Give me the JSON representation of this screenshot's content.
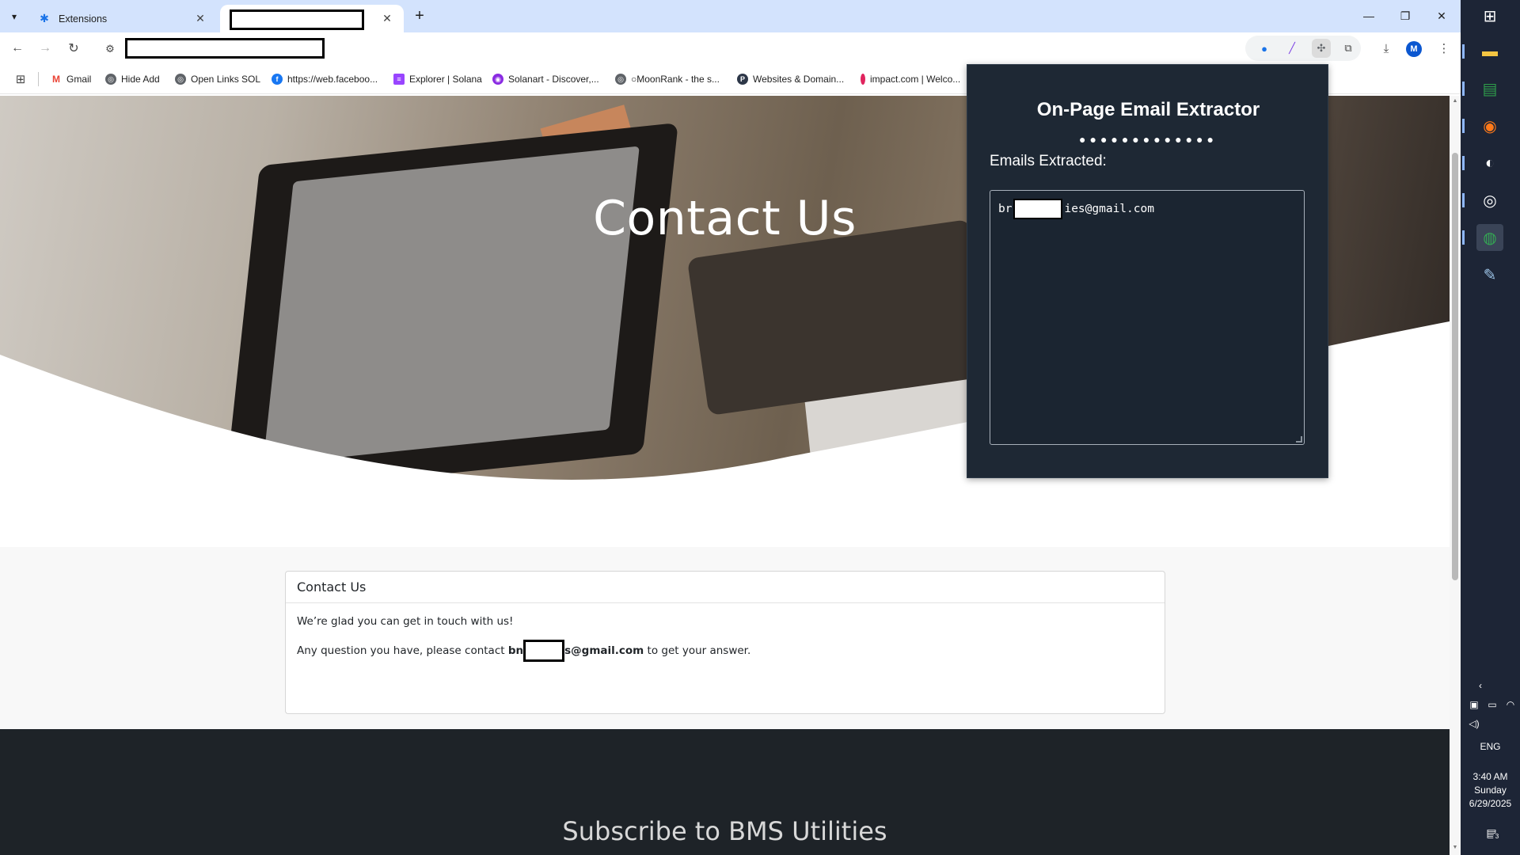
{
  "browser": {
    "tabs": [
      {
        "title": "Extensions",
        "icon": "puzzle-icon",
        "active": false
      },
      {
        "title": "",
        "icon": "redacted",
        "active": true,
        "redacted": true
      }
    ],
    "url_redacted": true,
    "window_controls": [
      "minimize",
      "restore",
      "close"
    ],
    "profile_initial": "M",
    "bookmarks": [
      {
        "label": "Gmail",
        "icon": "gmail-icon",
        "color": "#ea4335"
      },
      {
        "label": "Hide Add",
        "icon": "globe-icon",
        "color": "#5f6368"
      },
      {
        "label": "Open Links SOL",
        "icon": "globe-icon",
        "color": "#5f6368"
      },
      {
        "label": "https://web.faceboo...",
        "icon": "facebook-icon",
        "color": "#1877f2"
      },
      {
        "label": "Explorer | Solana",
        "icon": "solana-icon",
        "color": "#9945ff"
      },
      {
        "label": "Solanart - Discover,...",
        "icon": "solanart-icon",
        "color": "#8a2be2"
      },
      {
        "label": "○MoonRank - the s...",
        "icon": "globe-icon",
        "color": "#5f6368"
      },
      {
        "label": "Websites & Domain...",
        "icon": "p-icon",
        "color": "#2d3748"
      },
      {
        "label": "impact.com | Welco...",
        "icon": "impact-icon",
        "color": "#e0245e"
      }
    ]
  },
  "page": {
    "hero_title": "Contact Us",
    "card": {
      "header": "Contact Us",
      "line1": "We’re glad you can get in touch with us!",
      "line2_prefix": "Any question you have, please contact ",
      "email_start": "bn",
      "email_end": "s@gmail.com",
      "line2_suffix": " to get your answer."
    },
    "footer_title": "Subscribe to BMS Utilities"
  },
  "popup": {
    "title": "On-Page Email Extractor",
    "dots": "●●●●●●●●●●●●●",
    "label": "Emails Extracted:",
    "email_start": "br",
    "email_end": "ies@gmail.com"
  },
  "taskbar": {
    "apps": [
      "windows-start-icon",
      "file-explorer-icon",
      "spreadsheet-icon",
      "firefox-icon",
      "app-icon",
      "app-icon",
      "chrome-icon",
      "paint-icon"
    ],
    "language": "ENG",
    "time": "3:40 AM",
    "day": "Sunday",
    "date": "6/29/2025",
    "notification_count": "3"
  }
}
